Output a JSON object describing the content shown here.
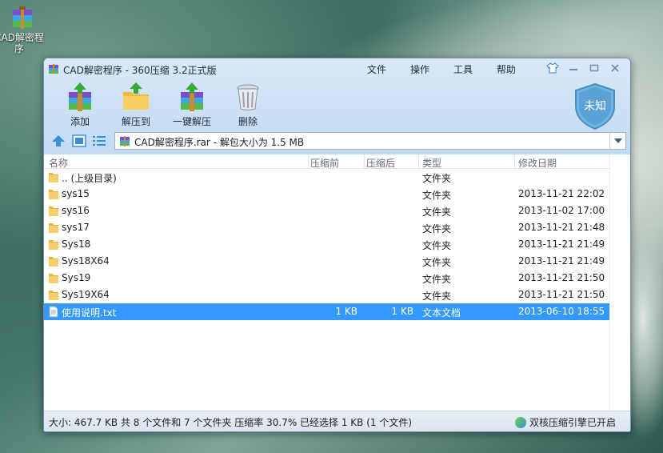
{
  "desktop": {
    "icon_label": "CAD解密程序"
  },
  "window": {
    "title": "CAD解密程序 - 360压缩 3.2正式版",
    "menu": [
      "文件",
      "操作",
      "工具",
      "帮助"
    ]
  },
  "toolbar": {
    "add_label": "添加",
    "extract_to_label": "解压到",
    "one_click_label": "一键解压",
    "delete_label": "删除"
  },
  "badge": {
    "label": "未知"
  },
  "address": {
    "value": "CAD解密程序.rar - 解包大小为 1.5 MB"
  },
  "columns": {
    "name": "名称",
    "before": "压缩前",
    "after": "压缩后",
    "type": "类型",
    "date": "修改日期"
  },
  "files": [
    {
      "name": ".. (上级目录)",
      "before": "",
      "after": "",
      "type": "文件夹",
      "date": "",
      "kind": "folder"
    },
    {
      "name": "sys15",
      "before": "",
      "after": "",
      "type": "文件夹",
      "date": "2013-11-21 22:02",
      "kind": "folder"
    },
    {
      "name": "sys16",
      "before": "",
      "after": "",
      "type": "文件夹",
      "date": "2013-11-02 17:00",
      "kind": "folder"
    },
    {
      "name": "sys17",
      "before": "",
      "after": "",
      "type": "文件夹",
      "date": "2013-11-21 21:48",
      "kind": "folder"
    },
    {
      "name": "Sys18",
      "before": "",
      "after": "",
      "type": "文件夹",
      "date": "2013-11-21 21:49",
      "kind": "folder"
    },
    {
      "name": "Sys18X64",
      "before": "",
      "after": "",
      "type": "文件夹",
      "date": "2013-11-21 21:49",
      "kind": "folder"
    },
    {
      "name": "Sys19",
      "before": "",
      "after": "",
      "type": "文件夹",
      "date": "2013-11-21 21:50",
      "kind": "folder"
    },
    {
      "name": "Sys19X64",
      "before": "",
      "after": "",
      "type": "文件夹",
      "date": "2013-11-21 21:50",
      "kind": "folder"
    },
    {
      "name": "使用说明.txt",
      "before": "1 KB",
      "after": "1 KB",
      "type": "文本文档",
      "date": "2013-06-10 18:55",
      "kind": "text",
      "selected": true
    }
  ],
  "status": {
    "summary": "大小: 467.7 KB 共 8 个文件和 7 个文件夹 压缩率 30.7% 已经选择 1 KB (1 个文件)",
    "engine": "双核压缩引擎已开启"
  },
  "colors": {
    "selection": "#3399ff",
    "folder": "#f2c14e",
    "titlebar": "#cfe2f6"
  }
}
